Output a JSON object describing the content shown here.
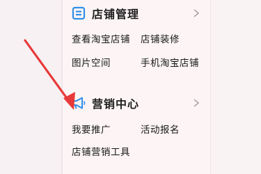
{
  "sections": [
    {
      "title": "店铺管理",
      "icon": "store-icon",
      "items": [
        "查看淘宝店铺",
        "店铺装修",
        "图片空间",
        "手机淘宝店铺"
      ]
    },
    {
      "title": "营销中心",
      "icon": "megaphone-icon",
      "items": [
        "我要推广",
        "活动报名",
        "店铺营销工具"
      ]
    }
  ],
  "colors": {
    "accent": "#2f8fea",
    "arrow": "#e8393a",
    "background": "#fcf4f5"
  }
}
